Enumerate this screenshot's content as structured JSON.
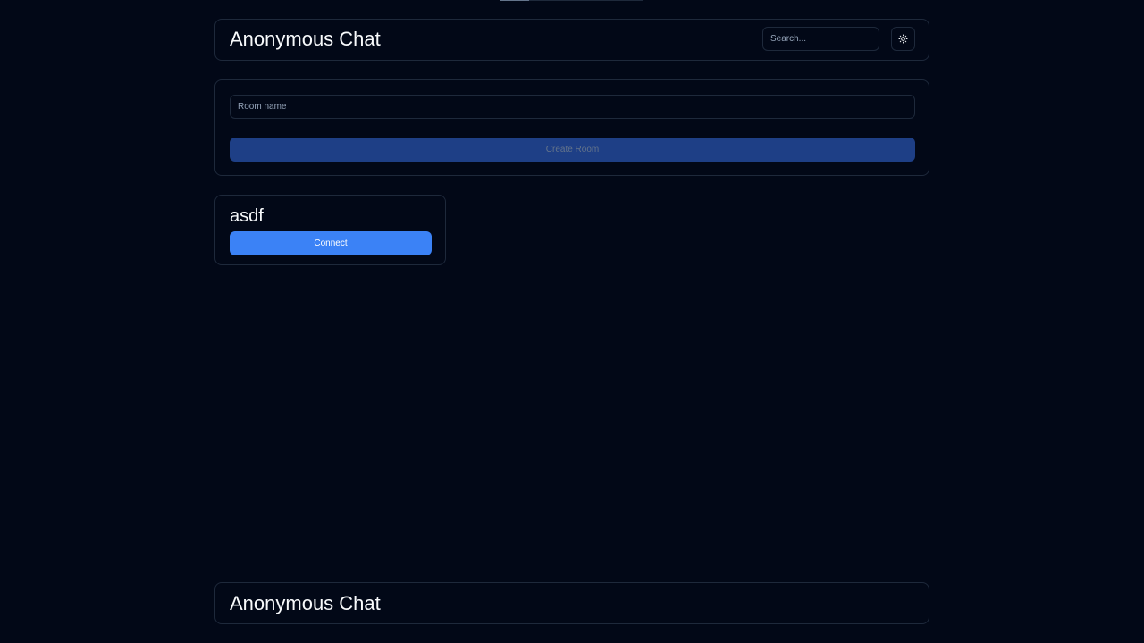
{
  "progress": {
    "value": 0.2
  },
  "header": {
    "title": "Anonymous Chat",
    "search_placeholder": "Search...",
    "theme_icon": "sun-icon"
  },
  "create_room": {
    "input_placeholder": "Room name",
    "button_label": "Create Room"
  },
  "rooms": [
    {
      "name": "asdf",
      "connect_label": "Connect"
    }
  ],
  "footer": {
    "title": "Anonymous Chat"
  },
  "colors": {
    "background": "#020817",
    "border": "#1e293b",
    "primary": "#3b82f6",
    "primary_disabled": "#1e3f86",
    "text": "#f8fafc",
    "muted": "#94a3b8"
  }
}
